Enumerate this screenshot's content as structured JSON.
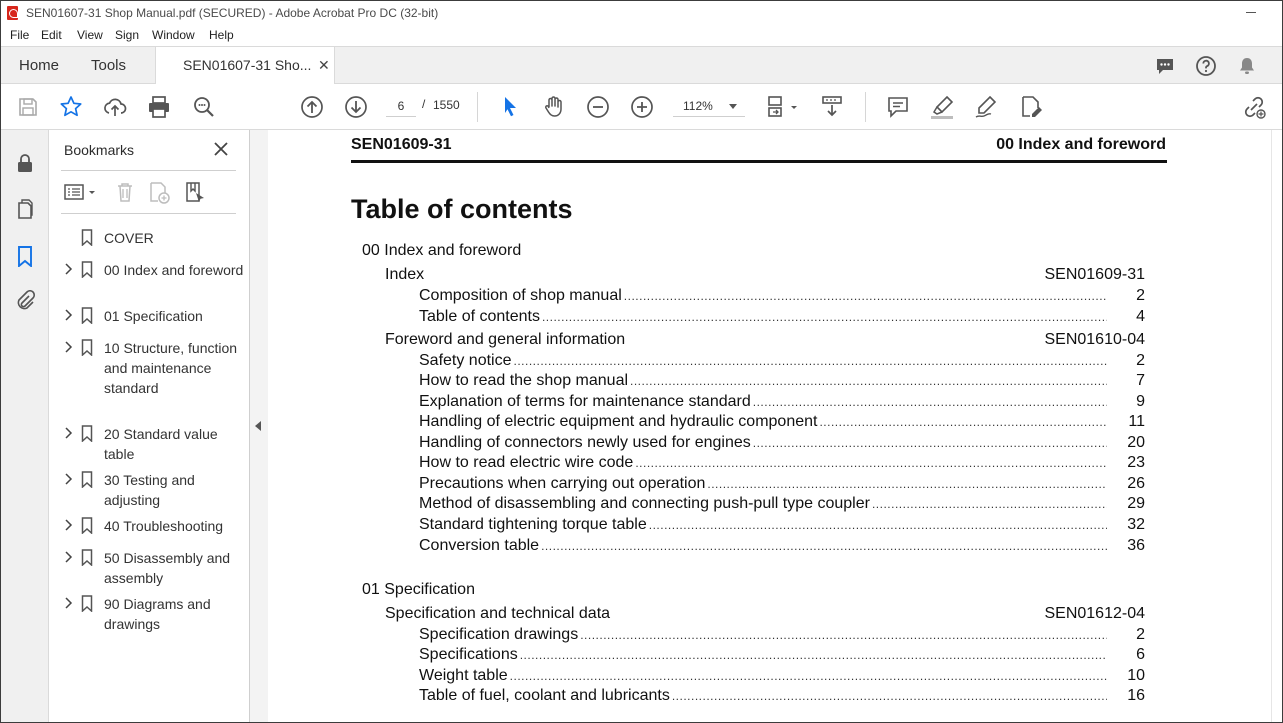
{
  "window": {
    "title": "SEN01607-31 Shop Manual.pdf (SECURED) - Adobe Acrobat Pro DC (32-bit)"
  },
  "menu": [
    "File",
    "Edit",
    "View",
    "Sign",
    "Window",
    "Help"
  ],
  "tabs": {
    "home": "Home",
    "tools": "Tools",
    "document": "SEN01607-31 Sho..."
  },
  "toolbar": {
    "page_current": "6",
    "page_sep": "/",
    "page_total": "1550",
    "zoom": "112%"
  },
  "bookmarks": {
    "title": "Bookmarks",
    "items": [
      {
        "label": "COVER",
        "expandable": false
      },
      {
        "label": "00 Index and foreword",
        "expandable": true
      },
      {
        "label": "01 Specification",
        "expandable": true
      },
      {
        "label": "10 Structure, function and maintenance standard",
        "expandable": true
      },
      {
        "label": "20 Standard value table",
        "expandable": true
      },
      {
        "label": "30 Testing and adjusting",
        "expandable": true
      },
      {
        "label": "40 Troubleshooting",
        "expandable": true
      },
      {
        "label": "50 Disassembly and assembly",
        "expandable": true
      },
      {
        "label": "90 Diagrams and drawings",
        "expandable": true
      }
    ]
  },
  "document": {
    "header_left": "SEN01609-31",
    "header_right": "00 Index and foreword",
    "title": "Table of contents",
    "sections": [
      {
        "title": "00 Index and foreword",
        "groups": [
          {
            "title": "Index",
            "code": "SEN01609-31",
            "entries": [
              {
                "title": "Composition of shop manual",
                "page": "2"
              },
              {
                "title": "Table of contents",
                "page": "4"
              }
            ]
          },
          {
            "title": "Foreword and general information",
            "code": "SEN01610-04",
            "entries": [
              {
                "title": "Safety notice",
                "page": "2"
              },
              {
                "title": "How to read the shop manual",
                "page": "7"
              },
              {
                "title": "Explanation of terms for maintenance standard",
                "page": "9"
              },
              {
                "title": "Handling of electric equipment and hydraulic component",
                "page": "11"
              },
              {
                "title": "Handling of connectors newly used for engines",
                "page": "20"
              },
              {
                "title": "How to read electric wire code",
                "page": "23"
              },
              {
                "title": "Precautions when carrying out operation",
                "page": "26"
              },
              {
                "title": "Method of disassembling and connecting push-pull type coupler",
                "page": "29"
              },
              {
                "title": "Standard tightening torque table",
                "page": "32"
              },
              {
                "title": "Conversion table",
                "page": "36"
              }
            ]
          }
        ]
      },
      {
        "title": "01 Specification",
        "groups": [
          {
            "title": "Specification and technical data",
            "code": "SEN01612-04",
            "entries": [
              {
                "title": "Specification drawings",
                "page": "2"
              },
              {
                "title": "Specifications",
                "page": "6"
              },
              {
                "title": "Weight table",
                "page": "10"
              },
              {
                "title": "Table of fuel, coolant and lubricants",
                "page": "16"
              }
            ]
          }
        ]
      }
    ]
  }
}
